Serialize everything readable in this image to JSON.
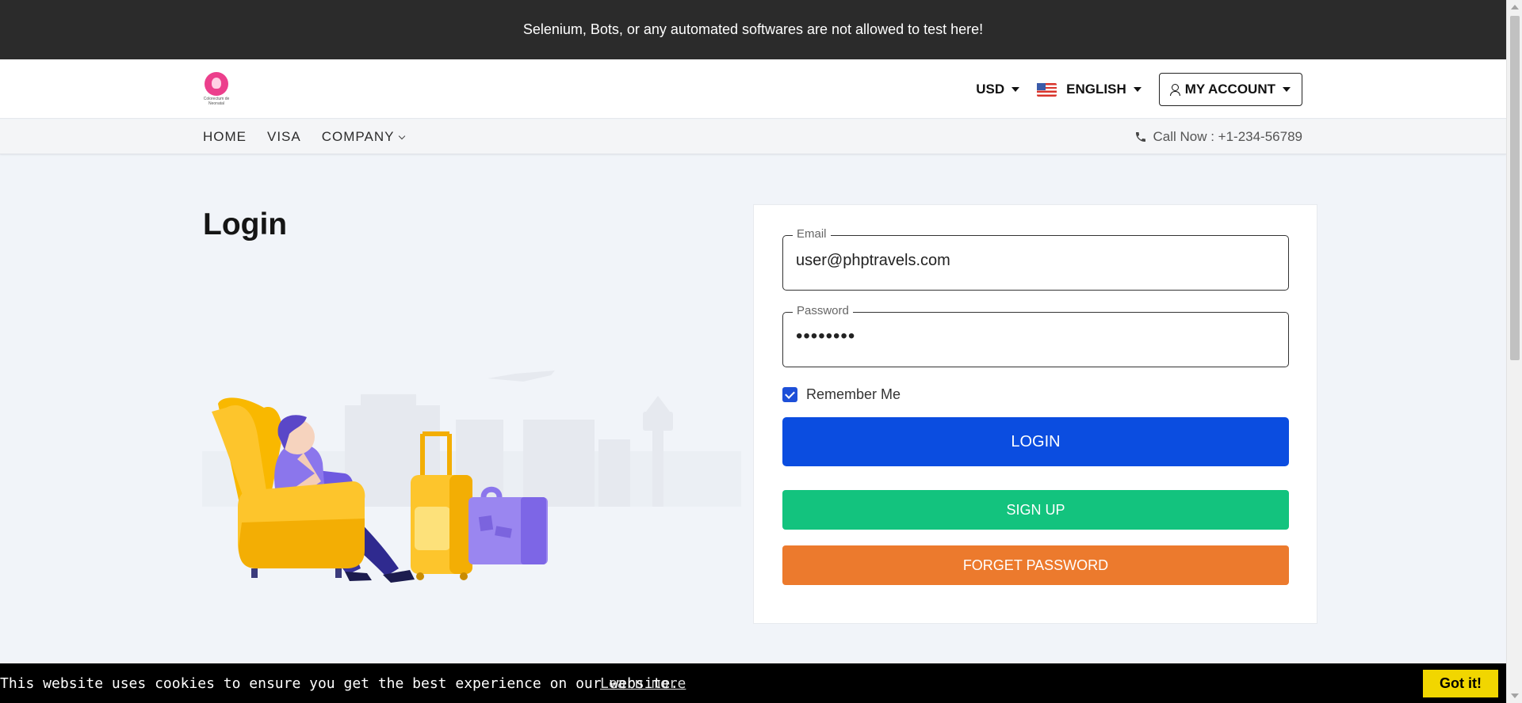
{
  "topbar": {
    "notice": "Selenium, Bots, or any automated softwares are not allowed to test here!"
  },
  "header": {
    "logo_caption": "Colorectum de Neonatal",
    "currency": "USD",
    "language": "ENGLISH",
    "account_label": "MY ACCOUNT"
  },
  "nav": {
    "items": [
      {
        "label": "HOME"
      },
      {
        "label": "VISA"
      },
      {
        "label": "COMPANY"
      }
    ],
    "call_text": "Call Now : +1-234-56789"
  },
  "page": {
    "title": "Login"
  },
  "form": {
    "email_label": "Email",
    "email_value": "user@phptravels.com",
    "password_label": "Password",
    "password_value": "••••••••",
    "remember_label": "Remember Me",
    "remember_checked": true,
    "login_label": "LOGIN",
    "signup_label": "SIGN UP",
    "forget_label": "FORGET PASSWORD"
  },
  "cookie": {
    "text": "This website uses cookies to ensure you get the best experience on our website.",
    "learn_more": "Learn more",
    "accept": "Got it!"
  },
  "colors": {
    "topbar": "#2b2b2b",
    "login": "#0b4de0",
    "signup": "#13c37e",
    "forget": "#ec7a2d",
    "cookie_button": "#f1d600"
  }
}
